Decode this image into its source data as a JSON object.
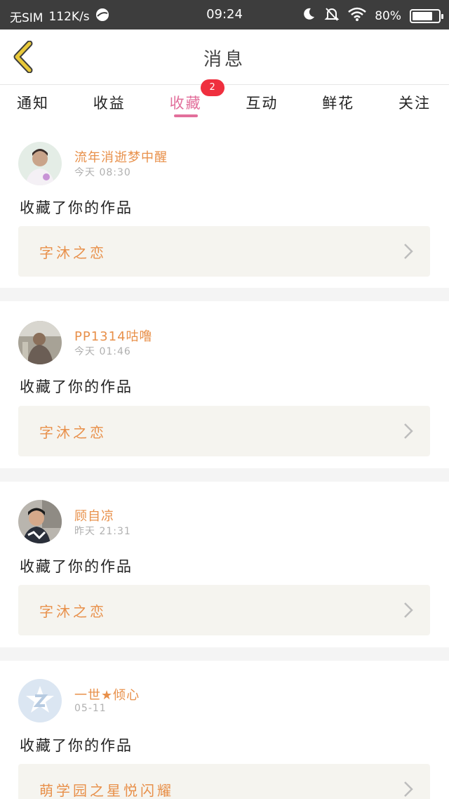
{
  "status_bar": {
    "carrier": "无SIM",
    "speed": "112K/s",
    "time": "09:24",
    "battery": "80%",
    "battery_level": 0.8
  },
  "header": {
    "title": "消息"
  },
  "tabs": [
    {
      "label": "通知",
      "active": false
    },
    {
      "label": "收益",
      "active": false
    },
    {
      "label": "收藏",
      "active": true,
      "badge": "2"
    },
    {
      "label": "互动",
      "active": false
    },
    {
      "label": "鲜花",
      "active": false
    },
    {
      "label": "关注",
      "active": false
    }
  ],
  "messages": [
    {
      "user": "流年消逝梦中醒",
      "time": "今天 08:30",
      "text": "收藏了你的作品",
      "work": "字沐之恋"
    },
    {
      "user": "PP1314咕噜",
      "time": "今天 01:46",
      "text": "收藏了你的作品",
      "work": "字沐之恋"
    },
    {
      "user": "顾自凉",
      "time": "昨天 21:31",
      "text": "收藏了你的作品",
      "work": "字沐之恋"
    },
    {
      "user": "一世★倾心",
      "time": "05-11",
      "text": "收藏了你的作品",
      "work": "萌学园之星悦闪耀"
    }
  ],
  "colors": {
    "accent": "#e26f9b",
    "name": "#e8904a",
    "badge": "#ef2f3e",
    "back_arrow": "#e9c93a"
  }
}
